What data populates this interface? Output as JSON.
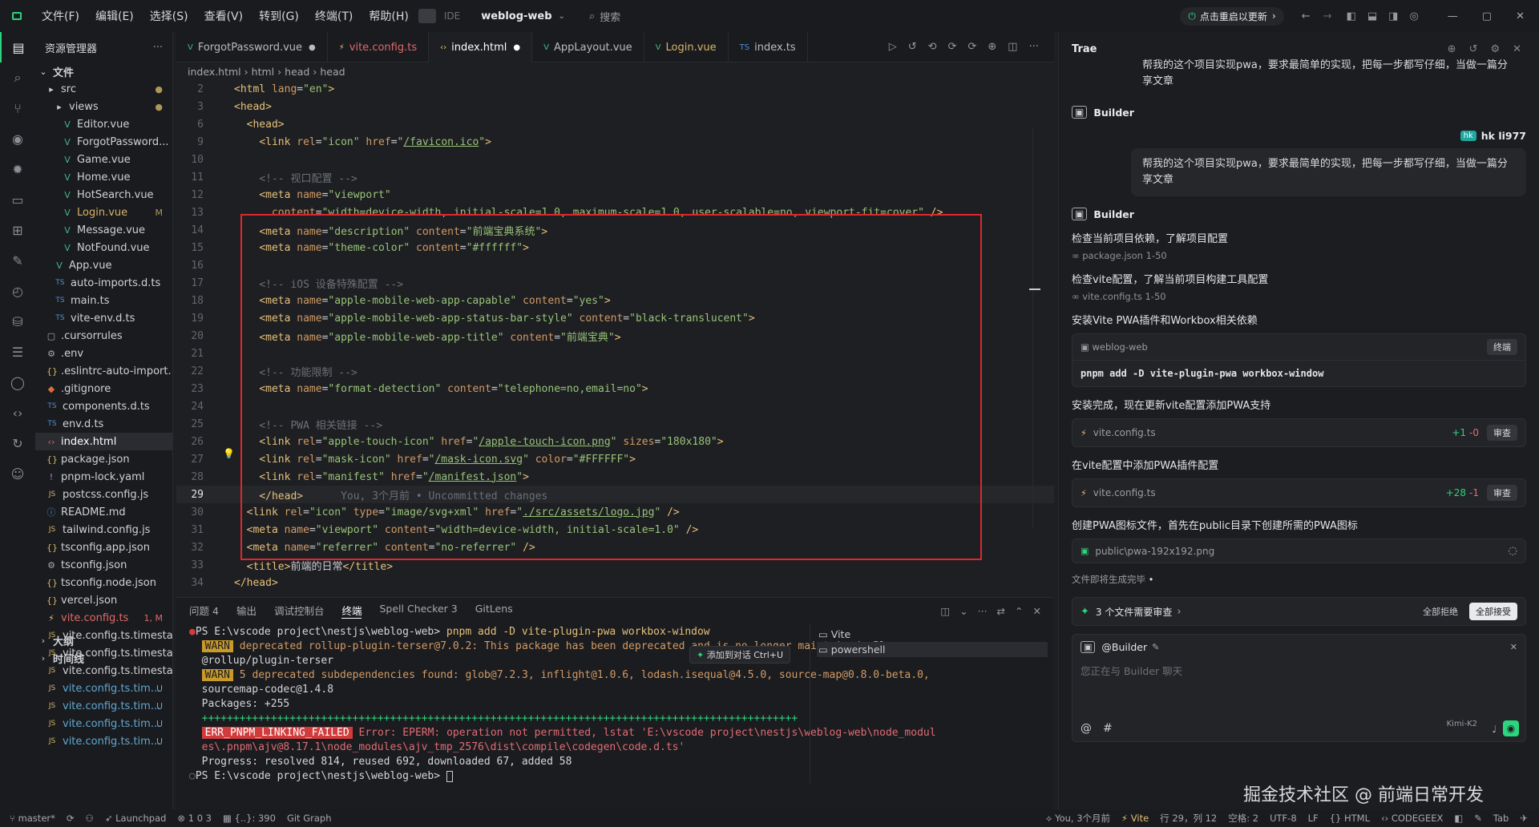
{
  "titlebar": {
    "menus": [
      "文件(F)",
      "编辑(E)",
      "选择(S)",
      "查看(V)",
      "转到(G)",
      "终端(T)",
      "帮助(H)"
    ],
    "ide_label": "IDE",
    "project": "weblog-web",
    "search_placeholder": "搜索",
    "update_label": "点击重启以更新"
  },
  "sidebar": {
    "title": "资源管理器",
    "section_files": "文件",
    "section_outline": "大纲",
    "section_timeline": "时间线",
    "tree": [
      {
        "label": "src",
        "indent": 1,
        "kind": "folder",
        "status": "●",
        "color": "#cfd2d6"
      },
      {
        "label": "views",
        "indent": 2,
        "kind": "folder",
        "status": "●",
        "color": "#cfd2d6"
      },
      {
        "label": "Editor.vue",
        "indent": 3,
        "kind": "vue",
        "status": "",
        "color": "#cfd2d6"
      },
      {
        "label": "ForgotPassword...",
        "indent": 3,
        "kind": "vue",
        "status": "",
        "color": "#cfd2d6"
      },
      {
        "label": "Game.vue",
        "indent": 3,
        "kind": "vue",
        "status": "",
        "color": "#cfd2d6"
      },
      {
        "label": "Home.vue",
        "indent": 3,
        "kind": "vue",
        "status": "",
        "color": "#cfd2d6"
      },
      {
        "label": "HotSearch.vue",
        "indent": 3,
        "kind": "vue",
        "status": "",
        "color": "#cfd2d6"
      },
      {
        "label": "Login.vue",
        "indent": 3,
        "kind": "vue",
        "status": "M",
        "color": "#d7b46a"
      },
      {
        "label": "Message.vue",
        "indent": 3,
        "kind": "vue",
        "status": "",
        "color": "#cfd2d6"
      },
      {
        "label": "NotFound.vue",
        "indent": 3,
        "kind": "vue",
        "status": "",
        "color": "#cfd2d6"
      },
      {
        "label": "App.vue",
        "indent": 2,
        "kind": "vue",
        "status": "",
        "color": "#cfd2d6"
      },
      {
        "label": "auto-imports.d.ts",
        "indent": 2,
        "kind": "ts",
        "status": "",
        "color": "#cfd2d6"
      },
      {
        "label": "main.ts",
        "indent": 2,
        "kind": "ts",
        "status": "",
        "color": "#cfd2d6"
      },
      {
        "label": "vite-env.d.ts",
        "indent": 2,
        "kind": "ts",
        "status": "",
        "color": "#cfd2d6"
      },
      {
        "label": ".cursorrules",
        "indent": 1,
        "kind": "file",
        "status": "",
        "color": "#cfd2d6"
      },
      {
        "label": ".env",
        "indent": 1,
        "kind": "gear",
        "status": "",
        "color": "#cfd2d6"
      },
      {
        "label": ".eslintrc-auto-import...",
        "indent": 1,
        "kind": "json",
        "status": "",
        "color": "#cfd2d6"
      },
      {
        "label": ".gitignore",
        "indent": 1,
        "kind": "git",
        "status": "",
        "color": "#cfd2d6"
      },
      {
        "label": "components.d.ts",
        "indent": 1,
        "kind": "ts",
        "status": "",
        "color": "#cfd2d6"
      },
      {
        "label": "env.d.ts",
        "indent": 1,
        "kind": "ts",
        "status": "",
        "color": "#cfd2d6"
      },
      {
        "label": "index.html",
        "indent": 1,
        "kind": "html",
        "status": "",
        "color": "#ffffff"
      },
      {
        "label": "package.json",
        "indent": 1,
        "kind": "json",
        "status": "",
        "color": "#cfd2d6"
      },
      {
        "label": "pnpm-lock.yaml",
        "indent": 1,
        "kind": "yaml",
        "status": "",
        "color": "#cfd2d6"
      },
      {
        "label": "postcss.config.js",
        "indent": 1,
        "kind": "js",
        "status": "",
        "color": "#cfd2d6"
      },
      {
        "label": "README.md",
        "indent": 1,
        "kind": "md",
        "status": "",
        "color": "#cfd2d6"
      },
      {
        "label": "tailwind.config.js",
        "indent": 1,
        "kind": "js",
        "status": "",
        "color": "#cfd2d6"
      },
      {
        "label": "tsconfig.app.json",
        "indent": 1,
        "kind": "json",
        "status": "",
        "color": "#cfd2d6"
      },
      {
        "label": "tsconfig.json",
        "indent": 1,
        "kind": "gear",
        "status": "",
        "color": "#cfd2d6"
      },
      {
        "label": "tsconfig.node.json",
        "indent": 1,
        "kind": "json",
        "status": "",
        "color": "#cfd2d6"
      },
      {
        "label": "vercel.json",
        "indent": 1,
        "kind": "json",
        "status": "",
        "color": "#cfd2d6"
      },
      {
        "label": "vite.config.ts",
        "indent": 1,
        "kind": "vite",
        "status": "1, M",
        "color": "#e0696b"
      },
      {
        "label": "vite.config.ts.timesta...",
        "indent": 1,
        "kind": "js",
        "status": "",
        "color": "#cfd2d6"
      },
      {
        "label": "vite.config.ts.timesta...",
        "indent": 1,
        "kind": "js",
        "status": "",
        "color": "#cfd2d6"
      },
      {
        "label": "vite.config.ts.timesta...",
        "indent": 1,
        "kind": "js",
        "status": "",
        "color": "#cfd2d6"
      },
      {
        "label": "vite.config.ts.tim...",
        "indent": 1,
        "kind": "js",
        "status": "U",
        "color": "#5fa8d3"
      },
      {
        "label": "vite.config.ts.tim...",
        "indent": 1,
        "kind": "js",
        "status": "U",
        "color": "#5fa8d3"
      },
      {
        "label": "vite.config.ts.tim...",
        "indent": 1,
        "kind": "js",
        "status": "U",
        "color": "#5fa8d3"
      },
      {
        "label": "vite.config.ts.tim...",
        "indent": 1,
        "kind": "js",
        "status": "U",
        "color": "#5fa8d3"
      }
    ]
  },
  "editor": {
    "tabs": [
      {
        "label": "ForgotPassword.vue",
        "icon": "V",
        "dot": "●",
        "color": "#b8bcc2"
      },
      {
        "label": "vite.config.ts",
        "icon": "⚡",
        "dot": "",
        "color": "#e0696b"
      },
      {
        "label": "index.html",
        "icon": "‹›",
        "dot": "●",
        "color": "#ffffff"
      },
      {
        "label": "AppLayout.vue",
        "icon": "V",
        "dot": "",
        "color": "#b8bcc2"
      },
      {
        "label": "Login.vue",
        "icon": "V",
        "dot": "",
        "color": "#d7b46a"
      },
      {
        "label": "index.ts",
        "icon": "TS",
        "dot": "",
        "color": "#b8bcc2"
      }
    ],
    "breadcrumb": [
      "index.html",
      "html",
      "head",
      "head"
    ],
    "blame": "You, 3个月前 • Uncommitted changes",
    "lines": [
      {
        "n": "2",
        "html": "<span class=\"t\">&lt;html</span> <span class=\"a\">lang</span><span class=\"p\">=</span><span class=\"s\">\"en\"</span><span class=\"t\">&gt;</span>"
      },
      {
        "n": "3",
        "html": "<span class=\"t\">&lt;head&gt;</span>"
      },
      {
        "n": "6",
        "html": "  <span class=\"t\">&lt;head&gt;</span>"
      },
      {
        "n": "9",
        "html": "    <span class=\"t\">&lt;link</span> <span class=\"a\">rel</span>=<span class=\"s\">\"icon\"</span> <span class=\"a\">href</span>=<span class=\"s\">\"</span><span class=\"u\">/favicon.ico</span><span class=\"s\">\"</span><span class=\"t\">&gt;</span>"
      },
      {
        "n": "10",
        "html": ""
      },
      {
        "n": "11",
        "html": "    <span class=\"c\">&lt;!-- 视口配置 --&gt;</span>"
      },
      {
        "n": "12",
        "html": "    <span class=\"t\">&lt;meta</span> <span class=\"a\">name</span>=<span class=\"s\">\"viewport\"</span>"
      },
      {
        "n": "13",
        "html": "      <span class=\"a\">content</span>=<span class=\"s\">\"width=device-width, initial-scale=1.0, maximum-scale=1.0, user-scalable=no, viewport-fit=cover\"</span> <span class=\"t\">/&gt;</span>"
      },
      {
        "n": "14",
        "html": "    <span class=\"t\">&lt;meta</span> <span class=\"a\">name</span>=<span class=\"s\">\"description\"</span> <span class=\"a\">content</span>=<span class=\"s\">\"前端宝典系统\"</span><span class=\"t\">&gt;</span>"
      },
      {
        "n": "15",
        "html": "    <span class=\"t\">&lt;meta</span> <span class=\"a\">name</span>=<span class=\"s\">\"theme-color\"</span> <span class=\"a\">content</span>=<span class=\"s\">\"#ffffff\"</span><span class=\"t\">&gt;</span>"
      },
      {
        "n": "16",
        "html": ""
      },
      {
        "n": "17",
        "html": "    <span class=\"c\">&lt;!-- iOS 设备特殊配置 --&gt;</span>"
      },
      {
        "n": "18",
        "html": "    <span class=\"t\">&lt;meta</span> <span class=\"a\">name</span>=<span class=\"s\">\"apple-mobile-web-app-capable\"</span> <span class=\"a\">content</span>=<span class=\"s\">\"yes\"</span><span class=\"t\">&gt;</span>"
      },
      {
        "n": "19",
        "html": "    <span class=\"t\">&lt;meta</span> <span class=\"a\">name</span>=<span class=\"s\">\"apple-mobile-web-app-status-bar-style\"</span> <span class=\"a\">content</span>=<span class=\"s\">\"black-translucent\"</span><span class=\"t\">&gt;</span>"
      },
      {
        "n": "20",
        "html": "    <span class=\"t\">&lt;meta</span> <span class=\"a\">name</span>=<span class=\"s\">\"apple-mobile-web-app-title\"</span> <span class=\"a\">content</span>=<span class=\"s\">\"前端宝典\"</span><span class=\"t\">&gt;</span>"
      },
      {
        "n": "21",
        "html": ""
      },
      {
        "n": "22",
        "html": "    <span class=\"c\">&lt;!-- 功能限制 --&gt;</span>"
      },
      {
        "n": "23",
        "html": "    <span class=\"t\">&lt;meta</span> <span class=\"a\">name</span>=<span class=\"s\">\"format-detection\"</span> <span class=\"a\">content</span>=<span class=\"s\">\"telephone=no,email=no\"</span><span class=\"t\">&gt;</span>"
      },
      {
        "n": "24",
        "html": ""
      },
      {
        "n": "25",
        "html": "    <span class=\"c\">&lt;!-- PWA 相关链接 --&gt;</span>"
      },
      {
        "n": "26",
        "html": "    <span class=\"t\">&lt;link</span> <span class=\"a\">rel</span>=<span class=\"s\">\"apple-touch-icon\"</span> <span class=\"a\">href</span>=<span class=\"s\">\"</span><span class=\"u\">/apple-touch-icon.png</span><span class=\"s\">\"</span> <span class=\"a\">sizes</span>=<span class=\"s\">\"180x180\"</span><span class=\"t\">&gt;</span>"
      },
      {
        "n": "27",
        "html": "    <span class=\"t\">&lt;link</span> <span class=\"a\">rel</span>=<span class=\"s\">\"mask-icon\"</span> <span class=\"a\">href</span>=<span class=\"s\">\"</span><span class=\"u\">/mask-icon.svg</span><span class=\"s\">\"</span> <span class=\"a\">color</span>=<span class=\"s\">\"#FFFFFF\"</span><span class=\"t\">&gt;</span>"
      },
      {
        "n": "28",
        "html": "    <span class=\"t\">&lt;link</span> <span class=\"a\">rel</span>=<span class=\"s\">\"manifest\"</span> <span class=\"a\">href</span>=<span class=\"s\">\"</span><span class=\"u\">/manifest.json</span><span class=\"s\">\"</span><span class=\"t\">&gt;</span>"
      },
      {
        "n": "29",
        "html": "    <span class=\"t\">&lt;/head&gt;</span>      <span class=\"c\">You, 3个月前 • Uncommitted changes</span>"
      },
      {
        "n": "30",
        "html": "  <span class=\"t\">&lt;link</span> <span class=\"a\">rel</span>=<span class=\"s\">\"icon\"</span> <span class=\"a\">type</span>=<span class=\"s\">\"image/svg+xml\"</span> <span class=\"a\">href</span>=<span class=\"s\">\"</span><span class=\"u\">./src/assets/logo.jpg</span><span class=\"s\">\"</span> <span class=\"t\">/&gt;</span>"
      },
      {
        "n": "31",
        "html": "  <span class=\"t\">&lt;meta</span> <span class=\"a\">name</span>=<span class=\"s\">\"viewport\"</span> <span class=\"a\">content</span>=<span class=\"s\">\"width=device-width, initial-scale=1.0\"</span> <span class=\"t\">/&gt;</span>"
      },
      {
        "n": "32",
        "html": "  <span class=\"t\">&lt;meta</span> <span class=\"a\">name</span>=<span class=\"s\">\"referrer\"</span> <span class=\"a\">content</span>=<span class=\"s\">\"no-referrer\"</span> <span class=\"t\">/&gt;</span>"
      },
      {
        "n": "33",
        "html": "  <span class=\"t\">&lt;title&gt;</span>前端的日常<span class=\"t\">&lt;/title&gt;</span>"
      },
      {
        "n": "34",
        "html": "<span class=\"t\">&lt;/head&gt;</span>"
      }
    ]
  },
  "panel": {
    "tabs": [
      "问题 4",
      "输出",
      "调试控制台",
      "终端",
      "Spell Checker 3",
      "GitLens"
    ],
    "active_tab": "终端",
    "add_to_chat": "添加到对话 Ctrl+U",
    "terminals": [
      "Vite",
      "powershell"
    ],
    "prompt1": "PS E:\\vscode project\\nestjs\\weblog-web> ",
    "cmd1": "pnpm add -D vite-plugin-pwa workbox-window",
    "warn_label": "WARN",
    "warn1": " deprecated rollup-plugin-terser@7.0.2: This package has been deprecated and is no longer maintained. Please use",
    "warn1b": "@rollup/plugin-terser",
    "warn2": " 5 deprecated subdependencies found: glob@7.2.3, inflight@1.0.6, lodash.isequal@4.5.0, source-map@0.8.0-beta.0,",
    "warn2b": "sourcemap-codec@1.4.8",
    "packages": "Packages: +255",
    "plus_line": "+++++++++++++++++++++++++++++++++++++++++++++++++++++++++++++++++++++++++++++++++++++++++++++++",
    "err_label": "ERR_PNPM_LINKING_FAILED",
    "err1": " Error: EPERM: operation not permitted, lstat 'E:\\vscode project\\nestjs\\weblog-web\\node_modul",
    "err2": "es\\.pnpm\\ajv@8.17.1\\node_modules\\ajv_tmp_2576\\dist\\compile\\codegen\\code.d.ts'",
    "progress": "Progress: resolved 814, reused 692, downloaded 67, added 58",
    "prompt2": "PS E:\\vscode project\\nestjs\\weblog-web> "
  },
  "chat": {
    "title": "Trae",
    "user_msg": "帮我的这个项目实现pwa，要求最简单的实现，把每一步都写仔细，当做一篇分享文章",
    "builder_label": "Builder",
    "user_name": "hk li977",
    "user_avatar": "hk",
    "step1": "检查当前项目依赖，了解项目配置",
    "ref1": "package.json 1-50",
    "step2": "检查vite配置，了解当前项目构建工具配置",
    "ref2": "vite.config.ts 1-50",
    "step3": "安装Vite PWA插件和Workbox相关依赖",
    "term_card_title": "weblog-web",
    "term_card_btn": "终端",
    "term_card_cmd": "pnpm add -D vite-plugin-pwa workbox-window",
    "step4": "安装完成，现在更新vite配置添加PWA支持",
    "file1": "vite.config.ts",
    "file1_diff_add": "+1",
    "file1_diff_del": "-0",
    "review_btn": "审查",
    "step5": "在vite配置中添加PWA插件配置",
    "file2": "vite.config.ts",
    "file2_diff_add": "+28",
    "file2_diff_del": "-1",
    "step6": "创建PWA图标文件，首先在public目录下创建所需的PWA图标",
    "file3": "public\\pwa-192x192.png",
    "generating": "文件即将生成完毕",
    "pending": "3 个文件需要审查",
    "reject_all": "全部拒绝",
    "accept_all": "全部接受",
    "mention": "@Builder",
    "input_placeholder": "您正在与 Builder 聊天",
    "model": "Kimi-K2",
    "watermark": "掘金技术社区 @ 前端日常开发"
  },
  "statusbar": {
    "branch": "master*",
    "launchpad": "Launchpad",
    "problems": "1  0  3",
    "position_info": "{..}: 390",
    "git_graph": "Git Graph",
    "blame": "You, 3个月前",
    "vite": "Vite",
    "cursor": "行 29，列 12",
    "spaces": "空格: 2",
    "encoding": "UTF-8",
    "eol": "LF",
    "language": "HTML",
    "codegeex": "CODEGEEX",
    "tab": "Tab"
  }
}
